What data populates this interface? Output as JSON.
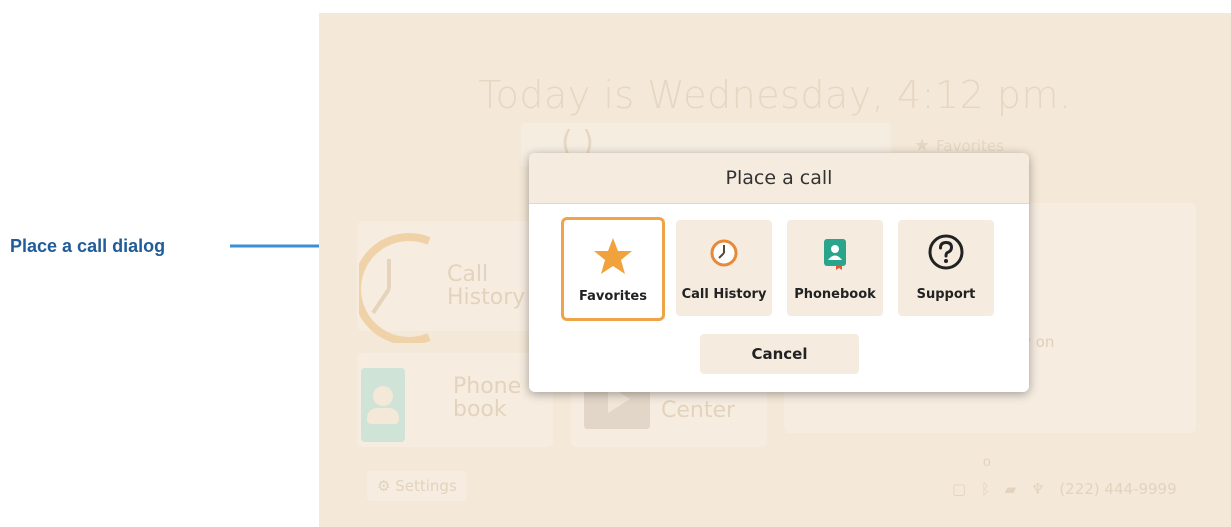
{
  "annotation": {
    "label": "Place a call dialog"
  },
  "screen": {
    "greeting": "Today is Wednesday, 4:12 pm.",
    "dial_prefix": "(   )",
    "favorites_top": "Favorites",
    "tiles": {
      "call_history": "Call\nHistory",
      "phonebook": "Phone\nbook",
      "video_center": "Center"
    },
    "right_panel_text": "y on",
    "settings_label": "Settings",
    "phone_number": "(222) 444-9999"
  },
  "dialog": {
    "title": "Place a call",
    "options": [
      {
        "label": "Favorites",
        "icon": "star-icon",
        "selected": true
      },
      {
        "label": "Call History",
        "icon": "clock-icon",
        "selected": false
      },
      {
        "label": "Phonebook",
        "icon": "phonebook-icon",
        "selected": false
      },
      {
        "label": "Support",
        "icon": "question-icon",
        "selected": false
      }
    ],
    "cancel_label": "Cancel"
  },
  "colors": {
    "accent": "#f0a44a",
    "annotation": "#1f5c99",
    "arrow": "#3b8fd6"
  }
}
